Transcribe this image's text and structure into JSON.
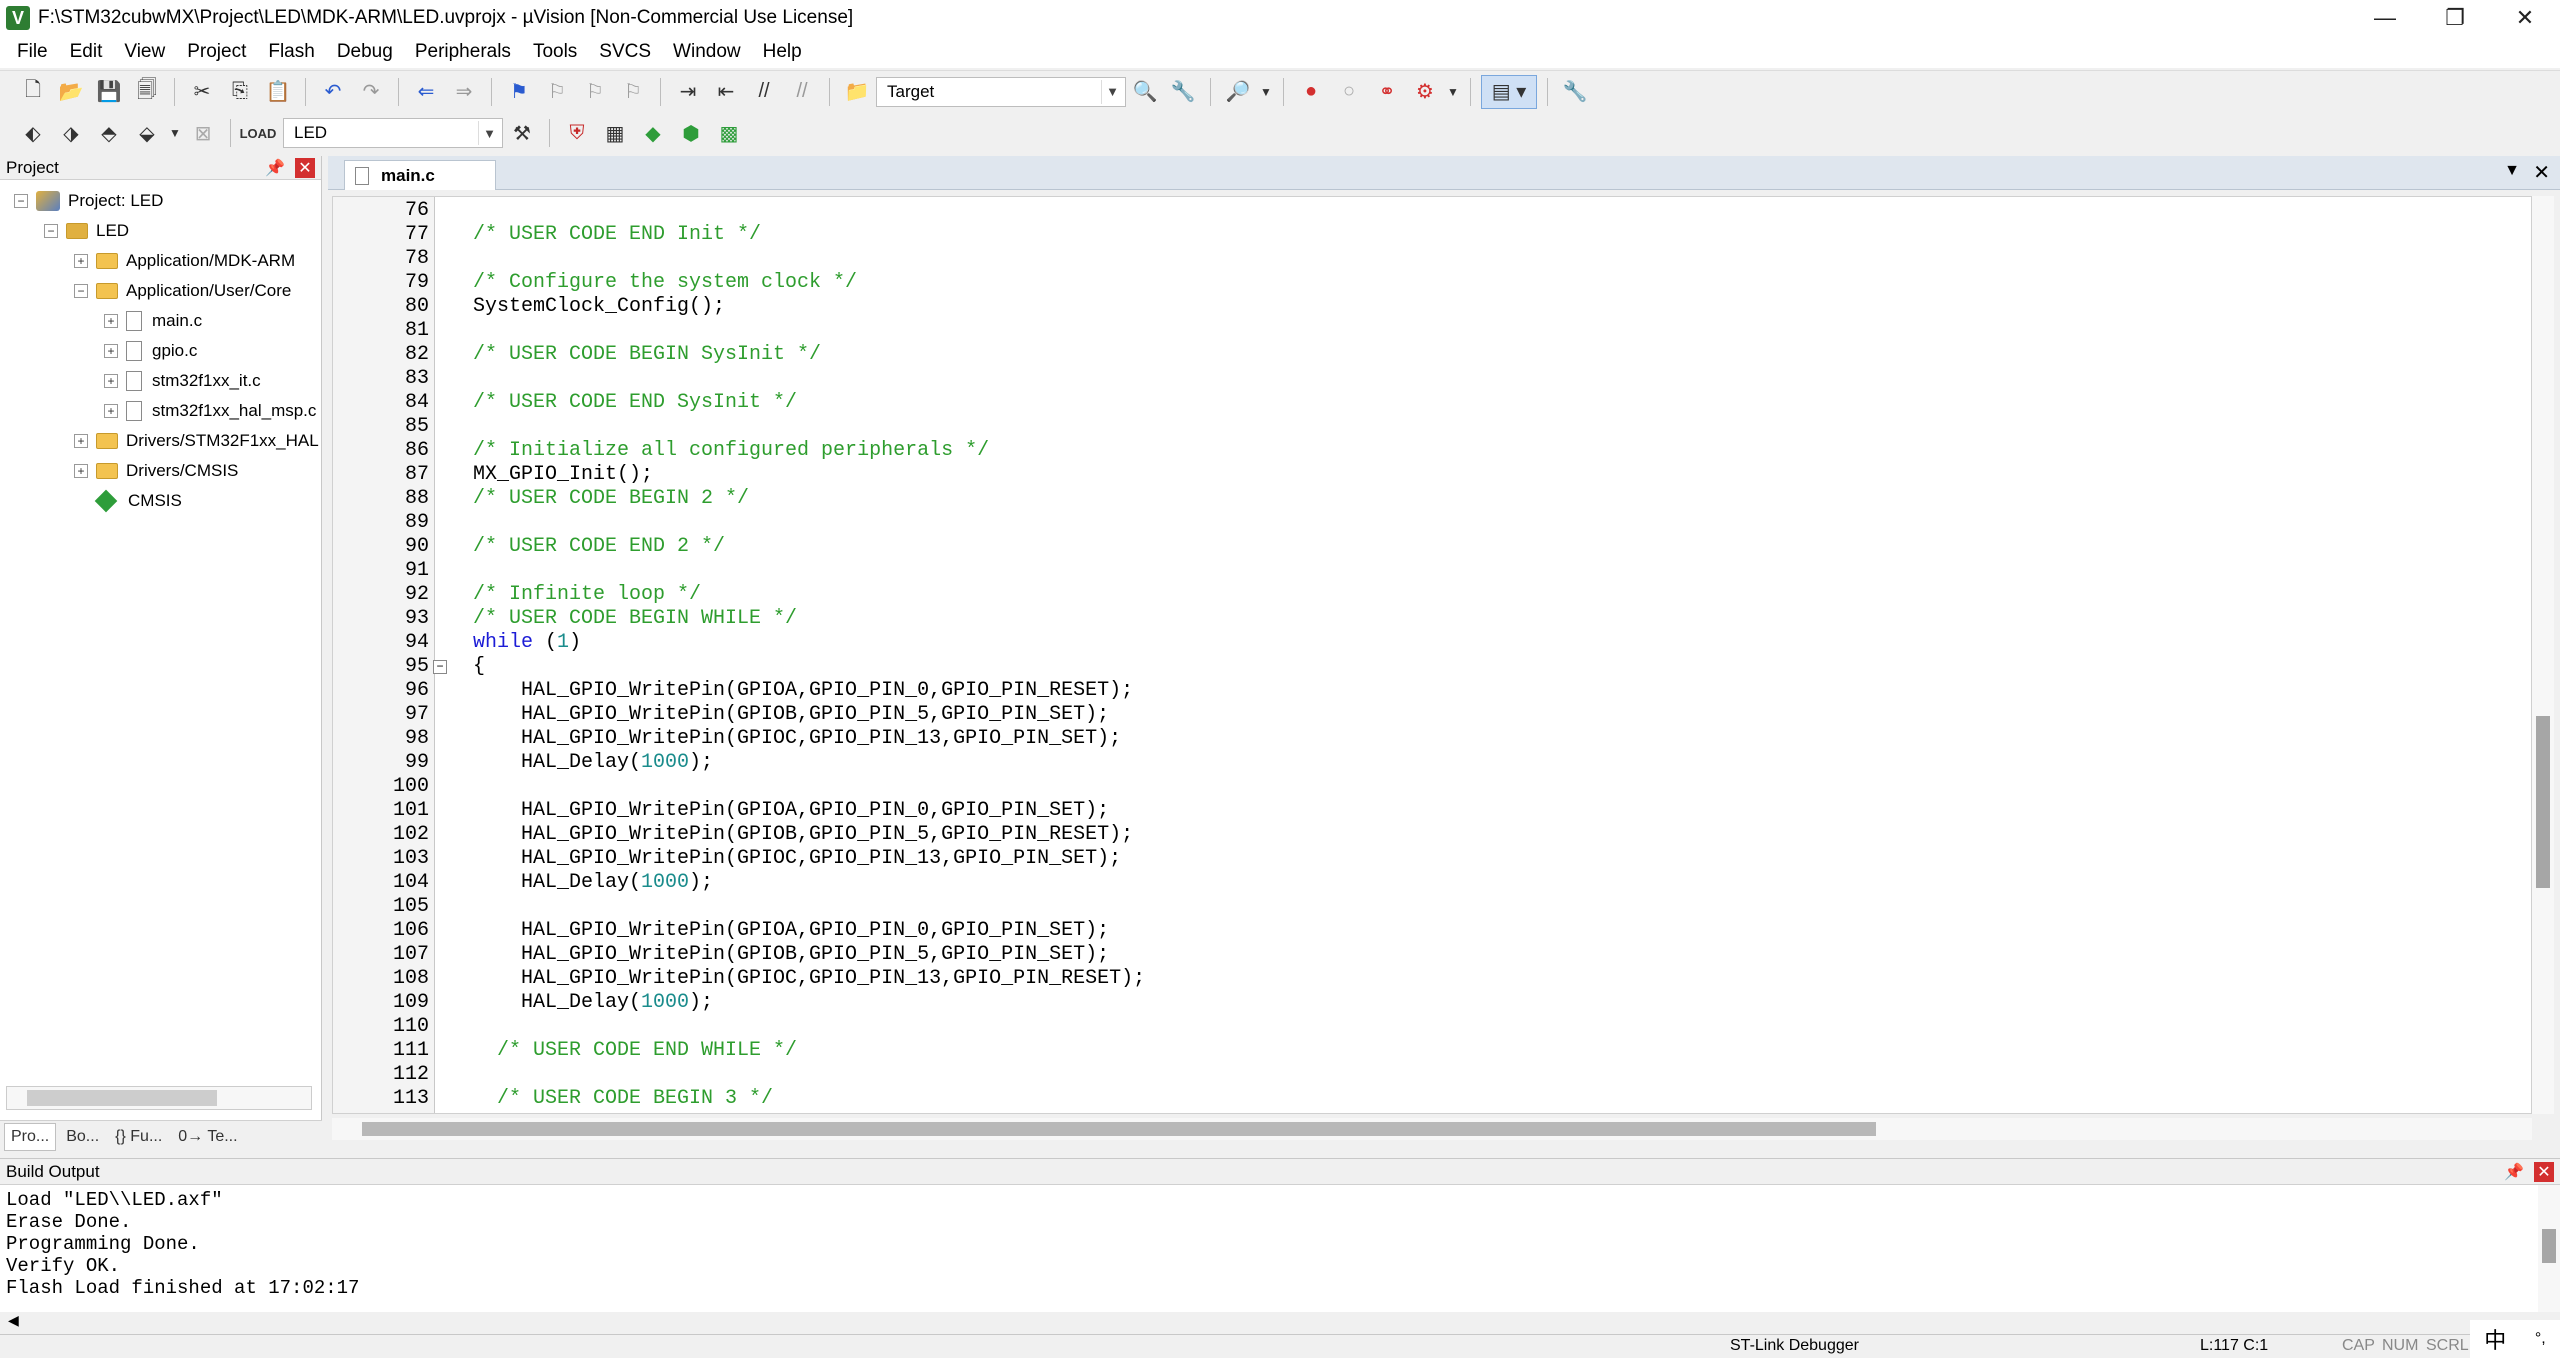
{
  "window": {
    "title": "F:\\STM32cubwMX\\Project\\LED\\MDK-ARM\\LED.uvprojx - µVision  [Non-Commercial Use License]",
    "minimize": "—",
    "restore": "❐",
    "close": "✕"
  },
  "menu": [
    "File",
    "Edit",
    "View",
    "Project",
    "Flash",
    "Debug",
    "Peripherals",
    "Tools",
    "SVCS",
    "Window",
    "Help"
  ],
  "toolbar": {
    "target_combo": "Target",
    "build_target_combo": "LED"
  },
  "project_panel": {
    "title": "Project",
    "tree": [
      {
        "label": "Project: LED",
        "level": 0,
        "type": "project"
      },
      {
        "label": "LED",
        "level": 1,
        "type": "target"
      },
      {
        "label": "Application/MDK-ARM",
        "level": 2,
        "type": "folder"
      },
      {
        "label": "Application/User/Core",
        "level": 2,
        "type": "folder"
      },
      {
        "label": "main.c",
        "level": 3,
        "type": "file"
      },
      {
        "label": "gpio.c",
        "level": 3,
        "type": "file"
      },
      {
        "label": "stm32f1xx_it.c",
        "level": 3,
        "type": "file"
      },
      {
        "label": "stm32f1xx_hal_msp.c",
        "level": 3,
        "type": "file"
      },
      {
        "label": "Drivers/STM32F1xx_HAL",
        "level": 2,
        "type": "folder"
      },
      {
        "label": "Drivers/CMSIS",
        "level": 2,
        "type": "folder"
      },
      {
        "label": "CMSIS",
        "level": 2,
        "type": "component"
      }
    ],
    "tabs": [
      "Pro...",
      "Bo...",
      "{} Fu...",
      "0→ Te..."
    ]
  },
  "editor": {
    "active_tab": "main.c",
    "lines": [
      {
        "n": "76",
        "t": ""
      },
      {
        "n": "77",
        "t": "/* USER CODE END Init */",
        "c": "cm"
      },
      {
        "n": "78",
        "t": ""
      },
      {
        "n": "79",
        "t": "/* Configure the system clock */",
        "c": "cm"
      },
      {
        "n": "80",
        "t": "SystemClock_Config();"
      },
      {
        "n": "81",
        "t": ""
      },
      {
        "n": "82",
        "t": "/* USER CODE BEGIN SysInit */",
        "c": "cm"
      },
      {
        "n": "83",
        "t": ""
      },
      {
        "n": "84",
        "t": "/* USER CODE END SysInit */",
        "c": "cm"
      },
      {
        "n": "85",
        "t": ""
      },
      {
        "n": "86",
        "t": "/* Initialize all configured peripherals */",
        "c": "cm"
      },
      {
        "n": "87",
        "t": "MX_GPIO_Init();"
      },
      {
        "n": "88",
        "t": "/* USER CODE BEGIN 2 */",
        "c": "cm"
      },
      {
        "n": "89",
        "t": ""
      },
      {
        "n": "90",
        "t": "/* USER CODE END 2 */",
        "c": "cm"
      },
      {
        "n": "91",
        "t": ""
      },
      {
        "n": "92",
        "t": "/* Infinite loop */",
        "c": "cm"
      },
      {
        "n": "93",
        "t": "/* USER CODE BEGIN WHILE */",
        "c": "cm"
      },
      {
        "n": "94",
        "t": "while (1)",
        "c": "kw"
      },
      {
        "n": "95",
        "t": "{",
        "fold": true
      },
      {
        "n": "96",
        "t": "    HAL_GPIO_WritePin(GPIOA,GPIO_PIN_0,GPIO_PIN_RESET);"
      },
      {
        "n": "97",
        "t": "    HAL_GPIO_WritePin(GPIOB,GPIO_PIN_5,GPIO_PIN_SET);"
      },
      {
        "n": "98",
        "t": "    HAL_GPIO_WritePin(GPIOC,GPIO_PIN_13,GPIO_PIN_SET);"
      },
      {
        "n": "99",
        "t": "    HAL_Delay(1000);"
      },
      {
        "n": "100",
        "t": ""
      },
      {
        "n": "101",
        "t": "    HAL_GPIO_WritePin(GPIOA,GPIO_PIN_0,GPIO_PIN_SET);"
      },
      {
        "n": "102",
        "t": "    HAL_GPIO_WritePin(GPIOB,GPIO_PIN_5,GPIO_PIN_RESET);"
      },
      {
        "n": "103",
        "t": "    HAL_GPIO_WritePin(GPIOC,GPIO_PIN_13,GPIO_PIN_SET);"
      },
      {
        "n": "104",
        "t": "    HAL_Delay(1000);"
      },
      {
        "n": "105",
        "t": ""
      },
      {
        "n": "106",
        "t": "    HAL_GPIO_WritePin(GPIOA,GPIO_PIN_0,GPIO_PIN_SET);"
      },
      {
        "n": "107",
        "t": "    HAL_GPIO_WritePin(GPIOB,GPIO_PIN_5,GPIO_PIN_SET);"
      },
      {
        "n": "108",
        "t": "    HAL_GPIO_WritePin(GPIOC,GPIO_PIN_13,GPIO_PIN_RESET);"
      },
      {
        "n": "109",
        "t": "    HAL_Delay(1000);"
      },
      {
        "n": "110",
        "t": ""
      },
      {
        "n": "111",
        "t": "  /* USER CODE END WHILE */",
        "c": "cm"
      },
      {
        "n": "112",
        "t": ""
      },
      {
        "n": "113",
        "t": "  /* USER CODE BEGIN 3 */",
        "c": "cm"
      }
    ]
  },
  "build_output": {
    "title": "Build Output",
    "lines": [
      "Load \"LED\\\\LED.axf\"",
      "Erase Done.",
      "Programming Done.",
      "Verify OK.",
      "Flash Load finished at 17:02:17"
    ]
  },
  "status": {
    "debugger": "ST-Link Debugger",
    "position": "L:117 C:1",
    "caps": "CAP",
    "num": "NUM",
    "scrl": "SCRL",
    "ime_lang": "中",
    "ime_mode": "°,"
  },
  "colors": {
    "comment": "#2e9d2e",
    "keyword": "#1c1cd6",
    "number": "#1a8c8c"
  }
}
